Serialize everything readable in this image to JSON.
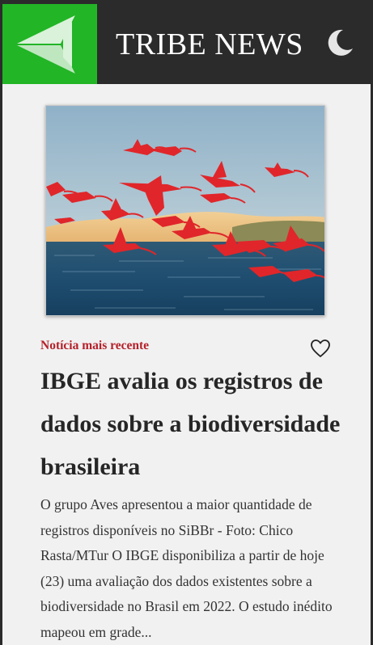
{
  "header": {
    "brand": "TRIBE NEWS",
    "logo_icon": "paper-plane-icon",
    "theme_icon": "moon-icon",
    "colors": {
      "background": "#2b2b2b",
      "logo_bg": "#22b526",
      "brand_text": "#ffffff"
    }
  },
  "article": {
    "image_alt": "Guarás vermelhos voando sobre o mar",
    "label": "Notícia mais recente",
    "favorite_icon": "heart-outline-icon",
    "title": "IBGE avalia os registros de dados sobre a biodiversidade brasileira",
    "summary": "O grupo Aves apresentou a maior quantidade de registros disponíveis no SiBBr - Foto: Chico Rasta/MTur O IBGE disponibiliza a partir de hoje (23) uma avaliação dos dados existentes sobre a biodiversidade no Brasil em 2022. O estudo inédito mapeou em grade...",
    "colors": {
      "label": "#b5212a",
      "title": "#262626",
      "card_bg": "#f1f1f1"
    }
  }
}
